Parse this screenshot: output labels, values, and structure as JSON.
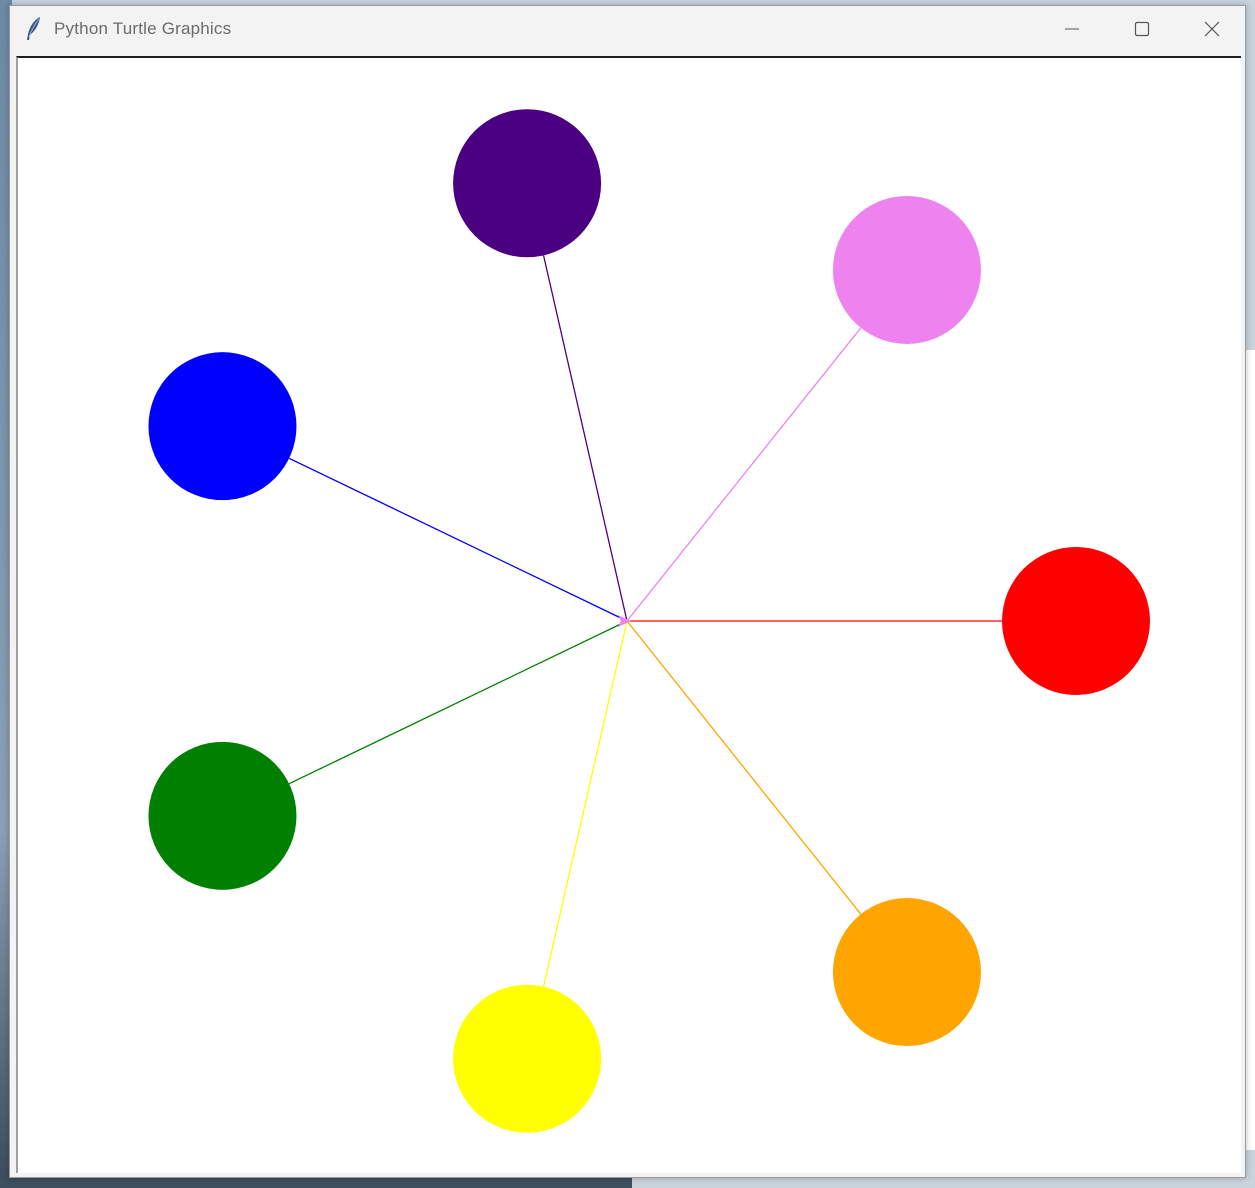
{
  "window": {
    "title": "Python Turtle Graphics"
  },
  "colors": {
    "titlebar_bg": "#f3f3f3",
    "canvas_bg": "#ffffff",
    "title_text": "#6b6b6b"
  },
  "icons": {
    "app": "feather-icon",
    "minimize": "minimize-icon",
    "maximize": "maximize-icon",
    "close": "close-icon"
  },
  "drawing": {
    "center_dot": "turtle-arrow",
    "spokes": [
      {
        "name": "red",
        "color": "#ff0000"
      },
      {
        "name": "violet",
        "color": "#ee82ee"
      },
      {
        "name": "indigo",
        "color": "#4b0082"
      },
      {
        "name": "blue",
        "color": "#0000ff"
      },
      {
        "name": "green",
        "color": "#008000"
      },
      {
        "name": "yellow",
        "color": "#ffff00"
      },
      {
        "name": "orange",
        "color": "#ffa500"
      }
    ]
  }
}
